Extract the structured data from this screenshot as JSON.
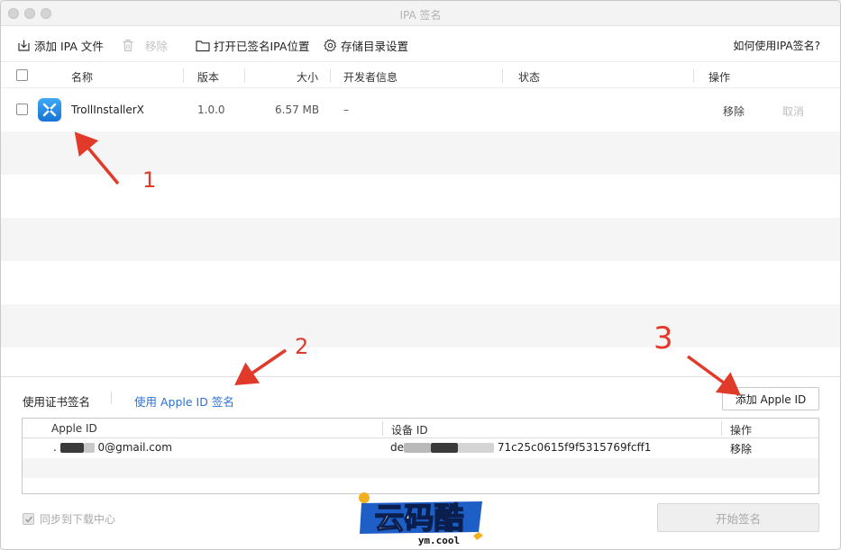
{
  "window": {
    "title": "IPA 签名"
  },
  "toolbar": {
    "add_ipa": "添加 IPA 文件",
    "remove": "移除",
    "open_signed": "打开已签名IPA位置",
    "storage_settings": "存储目录设置",
    "help": "如何使用IPA签名?"
  },
  "list": {
    "columns": {
      "name": "名称",
      "version": "版本",
      "size": "大小",
      "developer": "开发者信息",
      "status": "状态",
      "action": "操作"
    },
    "rows": [
      {
        "name": "TrollInstallerX",
        "version": "1.0.0",
        "size": "6.57 MB",
        "developer": "–",
        "status": "",
        "remove": "移除",
        "cancel": "取消"
      }
    ]
  },
  "panel": {
    "tab_cert": "使用证书签名",
    "tab_apple": "使用 Apple ID 签名",
    "add_apple_id": "添加 Apple ID",
    "table": {
      "columns": {
        "apple_id": "Apple ID",
        "device_id": "设备 ID",
        "action": "操作"
      },
      "rows": [
        {
          "apple_prefix": ".",
          "apple_suffix": "0@gmail.com",
          "device_prefix": "de",
          "device_suffix": "71c25c0615f9f5315769fcff1",
          "action": "移除"
        }
      ]
    },
    "sync": "同步到下载中心",
    "start": "开始签名"
  },
  "annotations": {
    "one": "1",
    "two": "2",
    "three": "3"
  },
  "watermark": {
    "brand": "云码酷",
    "domain": "ym.cool"
  },
  "colors": {
    "annotation_red": "#e23a2a",
    "link_blue": "#2a6fd6",
    "app_icon_blue": "#1f8bf0"
  }
}
